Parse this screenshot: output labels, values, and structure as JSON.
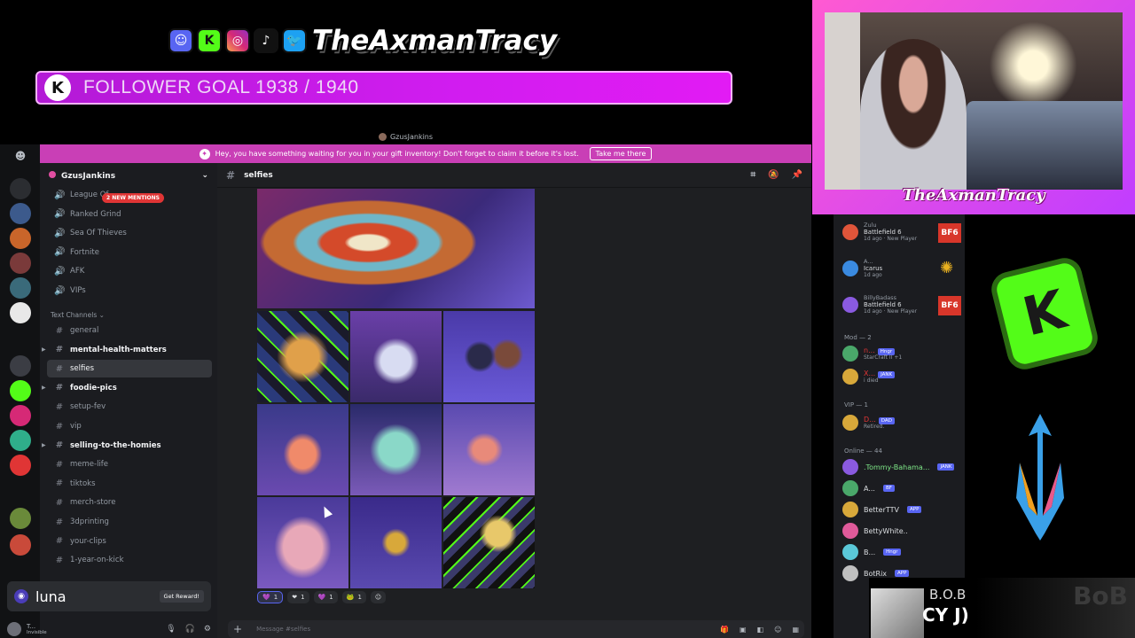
{
  "overlay": {
    "channel_name": "TheAxmanTracy",
    "goal_text": "FOLLOWER GOAL 1938 / 1940",
    "cam_sign": "TheAxmanTracy",
    "socials": [
      "discord-icon",
      "kick-icon",
      "instagram-icon",
      "tiktok-icon",
      "twitter-icon"
    ]
  },
  "window": {
    "title_user": "GzusJankins",
    "banner_text": "Hey, you have something waiting for you in your gift inventory! Don't forget to claim it before it's lost.",
    "banner_button": "Take me there"
  },
  "server": {
    "name": "GzusJankins",
    "mentions_badge": "2 NEW MENTIONS",
    "voice_channels": [
      "League Of",
      "Ranked Grind",
      "Sea Of Thieves",
      "Fortnite",
      "AFK",
      "VIPs"
    ],
    "category": "Text Channels",
    "text_channels": [
      {
        "name": "general",
        "bold": false
      },
      {
        "name": "mental-health-matters",
        "bold": true
      },
      {
        "name": "selfies",
        "bold": false,
        "active": true
      },
      {
        "name": "foodie-pics",
        "bold": true
      },
      {
        "name": "setup-fev",
        "bold": false
      },
      {
        "name": "vip",
        "bold": false
      },
      {
        "name": "selling-to-the-homies",
        "bold": true
      },
      {
        "name": "meme-life",
        "bold": false
      },
      {
        "name": "tiktoks",
        "bold": false
      },
      {
        "name": "merch-store",
        "bold": false
      },
      {
        "name": "3dprinting",
        "bold": false
      },
      {
        "name": "your-clips",
        "bold": false
      },
      {
        "name": "1-year-on-kick",
        "bold": false
      }
    ]
  },
  "luna": {
    "name": "luna",
    "reward_button": "Get Reward!"
  },
  "user": {
    "name": "T...",
    "status": "Invisible"
  },
  "channel": {
    "name": "selfies",
    "composer_placeholder": "Message #selfies",
    "reactions": [
      {
        "emoji": "💜",
        "count": "1"
      },
      {
        "emoji": "❤",
        "count": "1"
      },
      {
        "emoji": "💜",
        "count": "1"
      },
      {
        "emoji": "🐸",
        "count": "1"
      }
    ]
  },
  "members": {
    "top": [
      {
        "name": "Zulu",
        "game": "Battlefield 6",
        "sub": "1d ago · New Player"
      },
      {
        "name": "A...",
        "game": "Icarus",
        "sub": "1d ago"
      },
      {
        "name": "BillyBadass",
        "game": "Battlefield 6",
        "sub": "1d ago · New Player"
      }
    ],
    "mod_header": "Mod — 2",
    "mods": [
      {
        "name": "n...",
        "tag": "Hngr",
        "sub": "StarCraft II +1"
      },
      {
        "name": "X...",
        "tag": "JANK",
        "sub": "i died"
      }
    ],
    "vip_header": "VIP — 1",
    "vips": [
      {
        "name": "D...",
        "tag": "DAD",
        "sub": "Retired."
      }
    ],
    "online_header": "Online — 44",
    "online": [
      {
        "name": ".Tommy-Bahama...",
        "tag": "JANK",
        "color": "#7ee787"
      },
      {
        "name": "A...",
        "tag": "BF",
        "color": "#dbdee1"
      },
      {
        "name": "BetterTTV",
        "tag": "APP",
        "color": "#dbdee1"
      },
      {
        "name": "BettyWhite..",
        "tag": "",
        "color": "#dbdee1"
      },
      {
        "name": "B...",
        "tag": "Hngr",
        "color": "#dbdee1"
      },
      {
        "name": "BotRix",
        "tag": "APP",
        "color": "#dbdee1"
      }
    ]
  },
  "now_playing": {
    "artist": "B.O.B",
    "track": "CY J)",
    "logo": "BoB"
  },
  "colors": {
    "accent": "#5865f2",
    "banner": "#c93fb6",
    "kick": "#53fc18",
    "goal": "#d11cf0"
  }
}
